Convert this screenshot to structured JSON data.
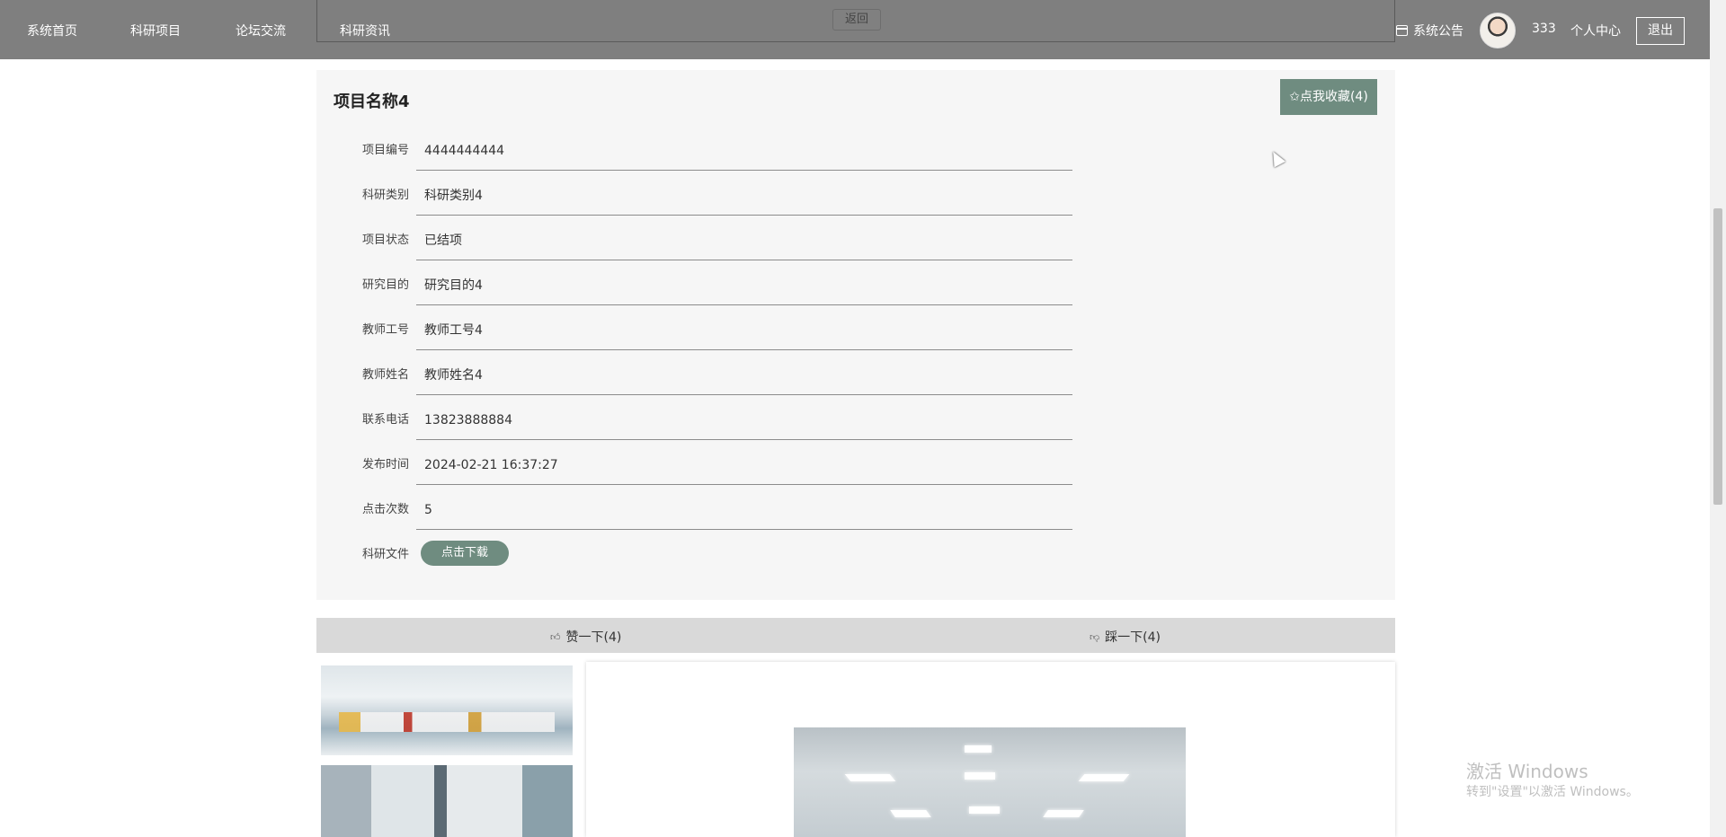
{
  "nav": {
    "items": [
      {
        "label": "系统首页"
      },
      {
        "label": "科研项目"
      },
      {
        "label": "论坛交流"
      },
      {
        "label": "科研资讯"
      }
    ],
    "back_label": "返回",
    "notice_label": "系统公告",
    "username": "333",
    "personal_center": "个人中心",
    "logout": "退出"
  },
  "detail": {
    "title": "项目名称4",
    "favorite_button": "✩点我收藏(4)",
    "fields": [
      {
        "label": "项目编号",
        "value": "4444444444"
      },
      {
        "label": "科研类别",
        "value": "科研类别4"
      },
      {
        "label": "项目状态",
        "value": "已结项"
      },
      {
        "label": "研究目的",
        "value": "研究目的4"
      },
      {
        "label": "教师工号",
        "value": "教师工号4"
      },
      {
        "label": "教师姓名",
        "value": "教师姓名4"
      },
      {
        "label": "联系电话",
        "value": "13823888884"
      },
      {
        "label": "发布时间",
        "value": "2024-02-21 16:37:27"
      },
      {
        "label": "点击次数",
        "value": "5"
      }
    ],
    "file_label": "科研文件",
    "download_button": "点击下载"
  },
  "votes": {
    "like": "赞一下(4)",
    "dislike": "踩一下(4)"
  },
  "watermark": {
    "title": "激活 Windows",
    "subtitle": "转到\"设置\"以激活 Windows。"
  },
  "colors": {
    "topbar": "#7f7f7f",
    "accent": "#6f8c80",
    "card_bg": "#f6f6f6",
    "vote_bar": "#d9d9d9"
  },
  "icons": {
    "notice": "calendar-icon",
    "like": "thumbs-up-icon",
    "dislike": "thumbs-down-icon",
    "favorite": "star-icon"
  }
}
